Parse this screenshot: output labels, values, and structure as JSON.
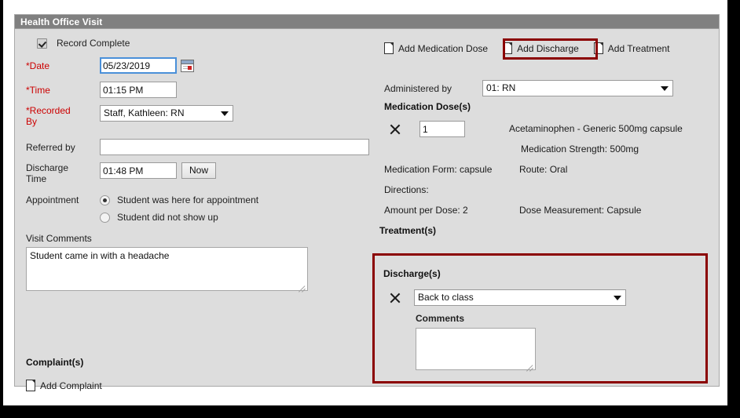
{
  "panel": {
    "title": "Health Office Visit"
  },
  "left": {
    "record_complete_label": "Record Complete",
    "date_label": "*Date",
    "date_value": "05/23/2019",
    "time_label": "*Time",
    "time_value": "01:15 PM",
    "recorded_by_label_line1": "*Recorded",
    "recorded_by_label_line2": "By",
    "recorded_by_value": "Staff, Kathleen: RN",
    "referred_by_label": "Referred by",
    "referred_by_value": "",
    "discharge_time_label_line1": "Discharge",
    "discharge_time_label_line2": "Time",
    "discharge_time_value": "01:48 PM",
    "now_button_label": "Now",
    "appointment_label": "Appointment",
    "appointment_option_1": "Student was here for appointment",
    "appointment_option_2": "Student did not show up",
    "visit_comments_label": "Visit Comments",
    "visit_comments_value": "Student came in with a headache",
    "complaints_heading": "Complaint(s)",
    "add_complaint_label": "Add Complaint"
  },
  "right": {
    "add_medication_dose_label": "Add Medication Dose",
    "add_discharge_label": "Add Discharge",
    "add_treatment_label": "Add Treatment",
    "administered_by_label": "Administered by",
    "administered_by_value": "01: RN",
    "medication_doses_heading": "Medication Dose(s)",
    "dose_quantity": "1",
    "medication_name": "Acetaminophen - Generic 500mg capsule",
    "medication_strength": "Medication Strength: 500mg",
    "medication_form": "Medication Form: capsule",
    "route": "Route: Oral",
    "directions": "Directions:",
    "amount_per_dose": "Amount per Dose: 2",
    "dose_measurement": "Dose Measurement: Capsule",
    "treatments_heading": "Treatment(s)",
    "discharges_heading": "Discharge(s)",
    "discharge_reason_value": "Back to class",
    "discharge_comments_label": "Comments",
    "discharge_comments_value": ""
  },
  "colors": {
    "panel_header_bg": "#808080",
    "panel_bg": "#dddddd",
    "required_label": "#cc0000",
    "highlight_border": "#8b0000",
    "focus_border": "#4a90d9"
  }
}
